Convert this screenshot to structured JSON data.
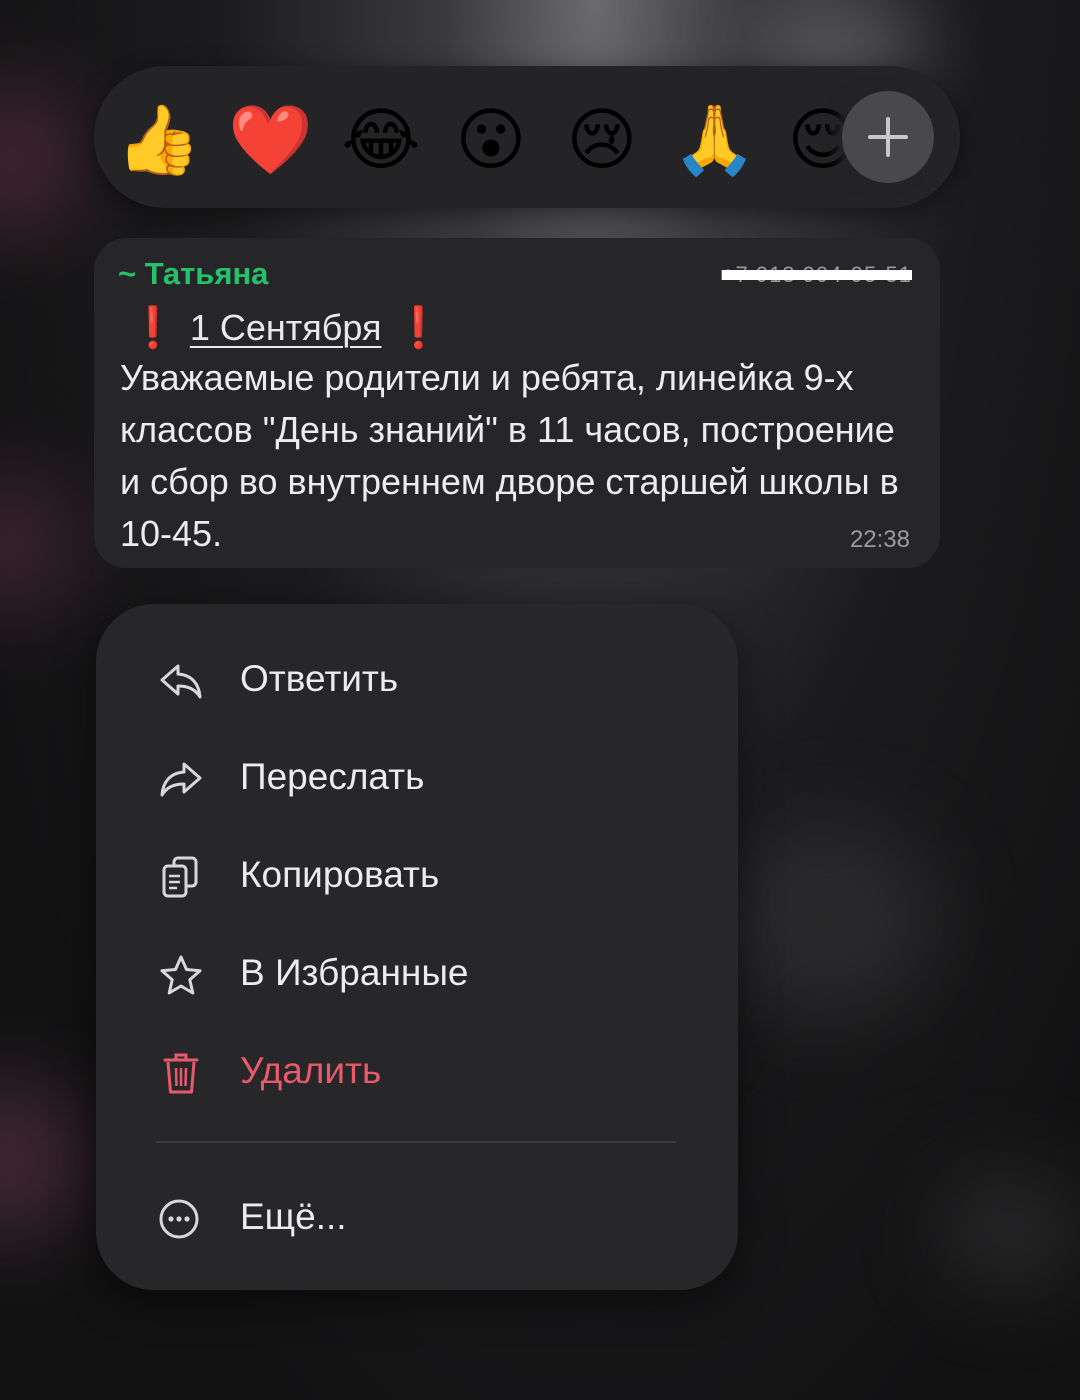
{
  "reactions": {
    "items": [
      {
        "emoji": "👍",
        "name": "thumbs-up"
      },
      {
        "emoji": "❤️",
        "name": "red-heart"
      },
      {
        "emoji": "😂",
        "name": "tears-of-joy"
      },
      {
        "emoji": "😮",
        "name": "surprised"
      },
      {
        "emoji": "😢",
        "name": "crying"
      },
      {
        "emoji": "🙏",
        "name": "folded-hands"
      },
      {
        "emoji": "😌",
        "name": "relieved"
      }
    ],
    "more_icon": "plus-icon"
  },
  "message": {
    "sender": "~ Татьяна",
    "phone": "+7 913 904-95-51",
    "headline_mark": "❗",
    "headline": "1 Сентября",
    "body": "Уважаемые родители и ребята, линейка 9-х классов \"День знаний\" в 11 часов, построение и сбор во внутреннем дворе старшей школы в 10-45.",
    "time": "22:38"
  },
  "menu": {
    "reply": "Ответить",
    "forward": "Переслать",
    "copy": "Копировать",
    "favorite": "В Избранные",
    "delete": "Удалить",
    "more": "Ещё..."
  },
  "colors": {
    "sender": "#25c26e",
    "danger": "#e8596a",
    "bubble": "#262628",
    "menu": "#272729"
  }
}
